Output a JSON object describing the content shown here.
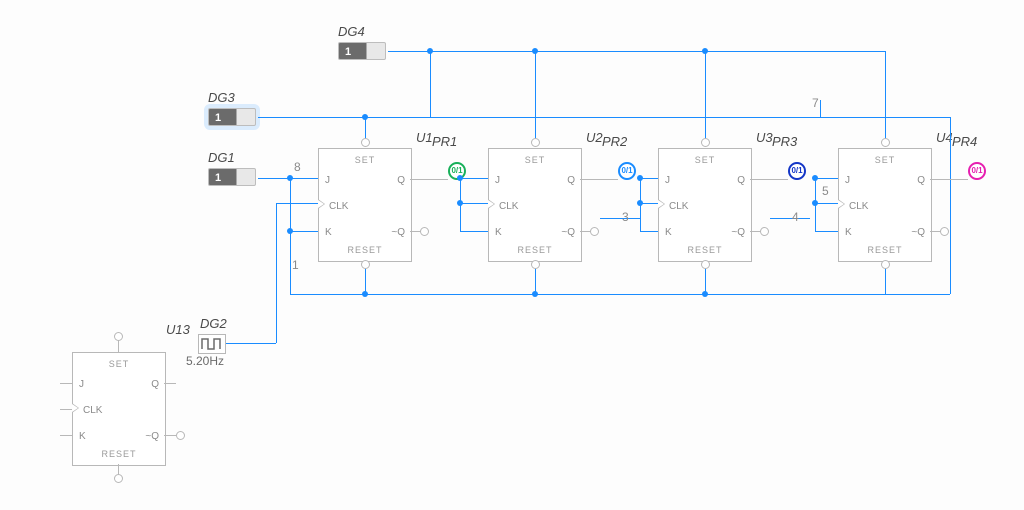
{
  "sources": {
    "dg1": {
      "label": "DG1",
      "value": "1"
    },
    "dg2": {
      "label": "DG2",
      "freq": "5.20Hz",
      "ref": "U13"
    },
    "dg3": {
      "label": "DG3",
      "value": "1"
    },
    "dg4": {
      "label": "DG4",
      "value": "1"
    }
  },
  "ff_pins": {
    "set": "SET",
    "reset": "RESET",
    "j": "J",
    "k": "K",
    "clk": "CLK",
    "q": "Q",
    "nq": "~Q"
  },
  "flipflops": [
    {
      "ref": "U1",
      "name": "U1"
    },
    {
      "ref": "U2",
      "name": "U2"
    },
    {
      "ref": "U3",
      "name": "U3"
    },
    {
      "ref": "U4",
      "name": "U4"
    }
  ],
  "probes": [
    {
      "name": "PR1",
      "text": "0/1",
      "color": "#18b05a"
    },
    {
      "name": "PR2",
      "text": "0/1",
      "color": "#1a8cff"
    },
    {
      "name": "PR3",
      "text": "0/1",
      "color": "#1436c7"
    },
    {
      "name": "PR4",
      "text": "0/1",
      "color": "#e61fb0"
    }
  ],
  "net_labels": {
    "n1": "1",
    "n3": "3",
    "n4": "4",
    "n7": "7",
    "n8": "8",
    "n5": "5"
  }
}
